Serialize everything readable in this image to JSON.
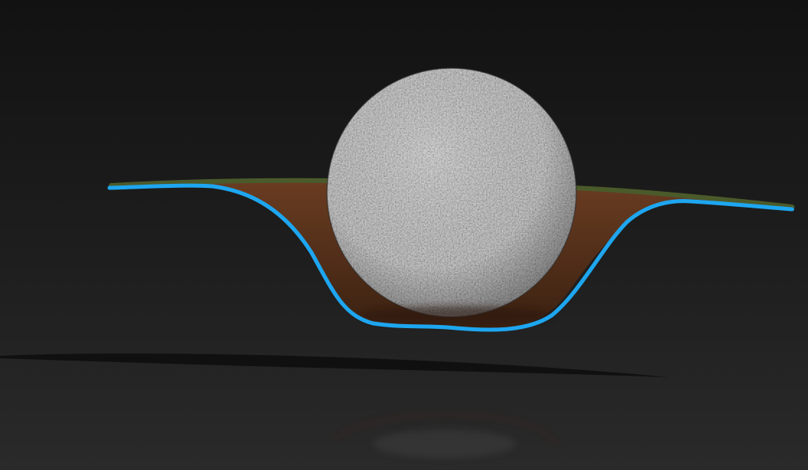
{
  "scene": {
    "subject": "granite-sphere-in-soil-depression",
    "colors": {
      "background_top": "#121212",
      "background_mid": "#1e1e1e",
      "background_bottom": "#2a2a2a",
      "floor_shadow": "#0e0e0e",
      "soil_light": "#6a3c21",
      "soil_dark": "#3a2111",
      "grass_edge": "#4b5a2a",
      "outline": "#1ea6f0",
      "stone_base": "#6f6f6f",
      "stone_light": "#a9a9a9",
      "stone_dark": "#2f2f2f",
      "reflection_red": "#5a1a1a"
    }
  }
}
